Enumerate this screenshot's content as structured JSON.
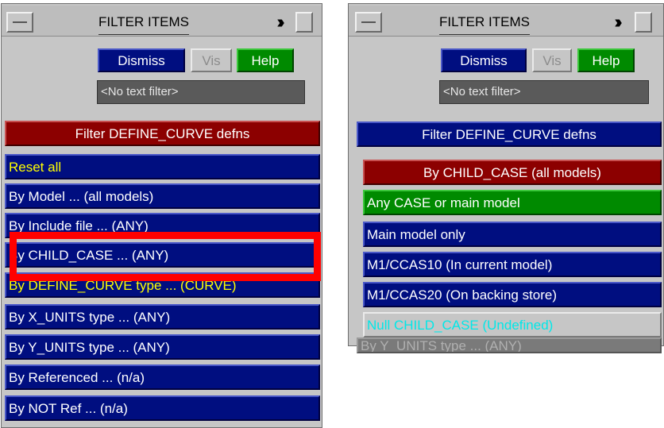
{
  "left_panel": {
    "title": "FILTER ITEMS",
    "buttons": {
      "dismiss": "Dismiss",
      "vis": "Vis",
      "help": "Help"
    },
    "text_filter": "<No text filter>",
    "header": "Filter DEFINE_CURVE defns",
    "items": [
      {
        "label": "Reset all"
      },
      {
        "label": "By Model ... (all models)"
      },
      {
        "label": "By Include file ... (ANY)"
      },
      {
        "label": "By CHILD_CASE ... (ANY)"
      },
      {
        "label": "By DEFINE_CURVE type ... (CURVE)"
      },
      {
        "label": "By X_UNITS type ... (ANY)"
      },
      {
        "label": "By Y_UNITS type ... (ANY)"
      },
      {
        "label": "By Referenced ... (n/a)"
      },
      {
        "label": "By NOT Ref ... (n/a)"
      }
    ]
  },
  "right_panel": {
    "title": "FILTER ITEMS",
    "buttons": {
      "dismiss": "Dismiss",
      "vis": "Vis",
      "help": "Help"
    },
    "text_filter": "<No text filter>",
    "header": "Filter DEFINE_CURVE defns",
    "popup": {
      "header": "By CHILD_CASE (all models)",
      "options": [
        {
          "label": "Any CASE or main model"
        },
        {
          "label": "Main model only"
        },
        {
          "label": "M1/CCAS10 (In current model)"
        },
        {
          "label": "M1/CCAS20 (On backing store)"
        },
        {
          "label": "Null CHILD_CASE (Undefined)"
        }
      ]
    },
    "behind_row": "By Y_UNITS type ... (ANY)"
  },
  "colors": {
    "panel_bg": "#c6c6c6",
    "item_blue": "#000e80",
    "header_red": "#8c0000",
    "help_green": "#008a00",
    "highlight": "#ff0000",
    "yellow_text": "#ffff00",
    "cyan_text": "#00e8e8"
  }
}
